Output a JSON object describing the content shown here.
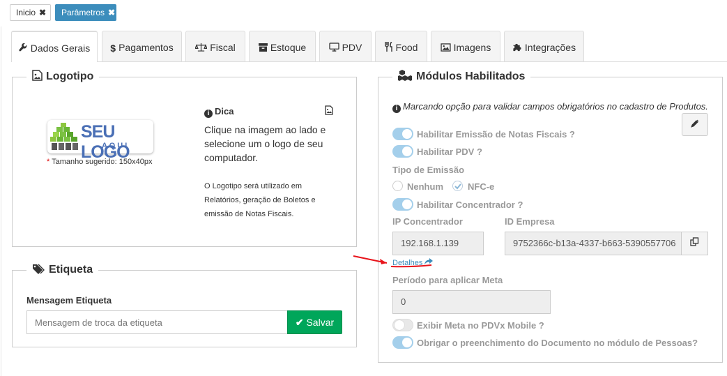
{
  "breadcrumbs": [
    {
      "label": "Inicio",
      "close": "✖"
    },
    {
      "label": "Parâmetros",
      "close": "✖"
    }
  ],
  "tabs": [
    {
      "label": "Dados Gerais",
      "icon": "wrench-icon"
    },
    {
      "label": "Pagamentos",
      "icon": "dollar-icon"
    },
    {
      "label": "Fiscal",
      "icon": "balance-scale-icon"
    },
    {
      "label": "Estoque",
      "icon": "archive-icon"
    },
    {
      "label": "PDV",
      "icon": "monitor-icon"
    },
    {
      "label": "Food",
      "icon": "utensils-icon"
    },
    {
      "label": "Imagens",
      "icon": "image-icon"
    },
    {
      "label": "Integrações",
      "icon": "puzzle-icon"
    }
  ],
  "logotipo": {
    "title": "Logotipo",
    "logo_text_main": "SEU LOGO",
    "logo_text_sub": "A Q U I",
    "size_hint_star": "*",
    "size_hint": " Tamanho sugerido: 150x40px",
    "tip_title": "Dica",
    "tip_text": "Clique na imagem ao lado e selecione um o logo de seu computador.",
    "tip_note": "O Logotipo será utilizado em Relatórios, geração de Boletos e emissão de Notas Fiscais."
  },
  "etiqueta": {
    "title": "Etiqueta",
    "field_label": "Mensagem Etiqueta",
    "placeholder": "Mensagem de troca da etiqueta",
    "save_label": "Salvar"
  },
  "modulos": {
    "title": "Módulos Habilitados",
    "info": "Marcando opção para validar campos obrigatórios no cadastro de Produtos.",
    "habilitar_nf": "Habilitar Emissão de Notas Fiscais ?",
    "habilitar_pdv": "Habilitar PDV ?",
    "tipo_emissao": "Tipo de Emissão",
    "opt_nenhum": "Nenhum",
    "opt_nfce": "NFC-e",
    "habilitar_concentrador": "Habilitar Concentrador ?",
    "ip_label": "IP Concentrador",
    "ip_value": "192.168.1.139",
    "id_label": "ID Empresa",
    "id_value": "9752366c-b13a-4337-b663-5390557706",
    "detalhes": "Detalhes",
    "periodo_label": "Período para aplicar Meta",
    "periodo_value": "0",
    "exibir_meta": "Exibir Meta no PDVx Mobile ?",
    "obrigar_doc": "Obrigar o preenchimento do Documento no módulo de Pessoas?"
  },
  "colors": {
    "accent": "#3c8dbc",
    "success": "#00a65a",
    "annotation": "#e8141b"
  }
}
